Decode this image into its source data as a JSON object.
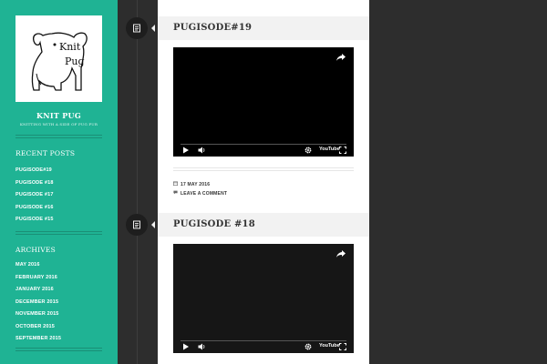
{
  "site": {
    "title": "KNIT PUG",
    "description": "KNITTING WITH A SIDE OF PUG FUR",
    "logo_text_1": "Knit",
    "logo_text_2": "Pug"
  },
  "sidebar": {
    "recent_posts_title": "RECENT POSTS",
    "recent_posts": [
      "PUGISODE#19",
      "PUGISODE #18",
      "PUGISODE #17",
      "PUGISODE #16",
      "PUGISODE #15"
    ],
    "archives_title": "ARCHIVES",
    "archives": [
      "MAY 2016",
      "FEBRUARY 2016",
      "JANUARY 2016",
      "DECEMBER 2015",
      "NOVEMBER 2015",
      "OCTOBER 2015",
      "SEPTEMBER 2015"
    ]
  },
  "posts": [
    {
      "title": "PUGISODE#19",
      "date": "17 MAY 2016",
      "comment_link": "LEAVE A COMMENT"
    },
    {
      "title": "PUGISODE #18"
    }
  ],
  "player": {
    "brand": "YouTube"
  },
  "icons": {
    "post_format": "standard-post-icon",
    "share": "share-icon",
    "play": "play-icon",
    "volume": "volume-icon",
    "settings": "settings-icon",
    "fullscreen": "fullscreen-icon",
    "calendar": "calendar-icon",
    "comment": "comment-icon"
  },
  "colors": {
    "sidebar": "#1fb394",
    "background": "#2d2d2d",
    "content": "#ffffff",
    "header": "#f2f2f2"
  }
}
